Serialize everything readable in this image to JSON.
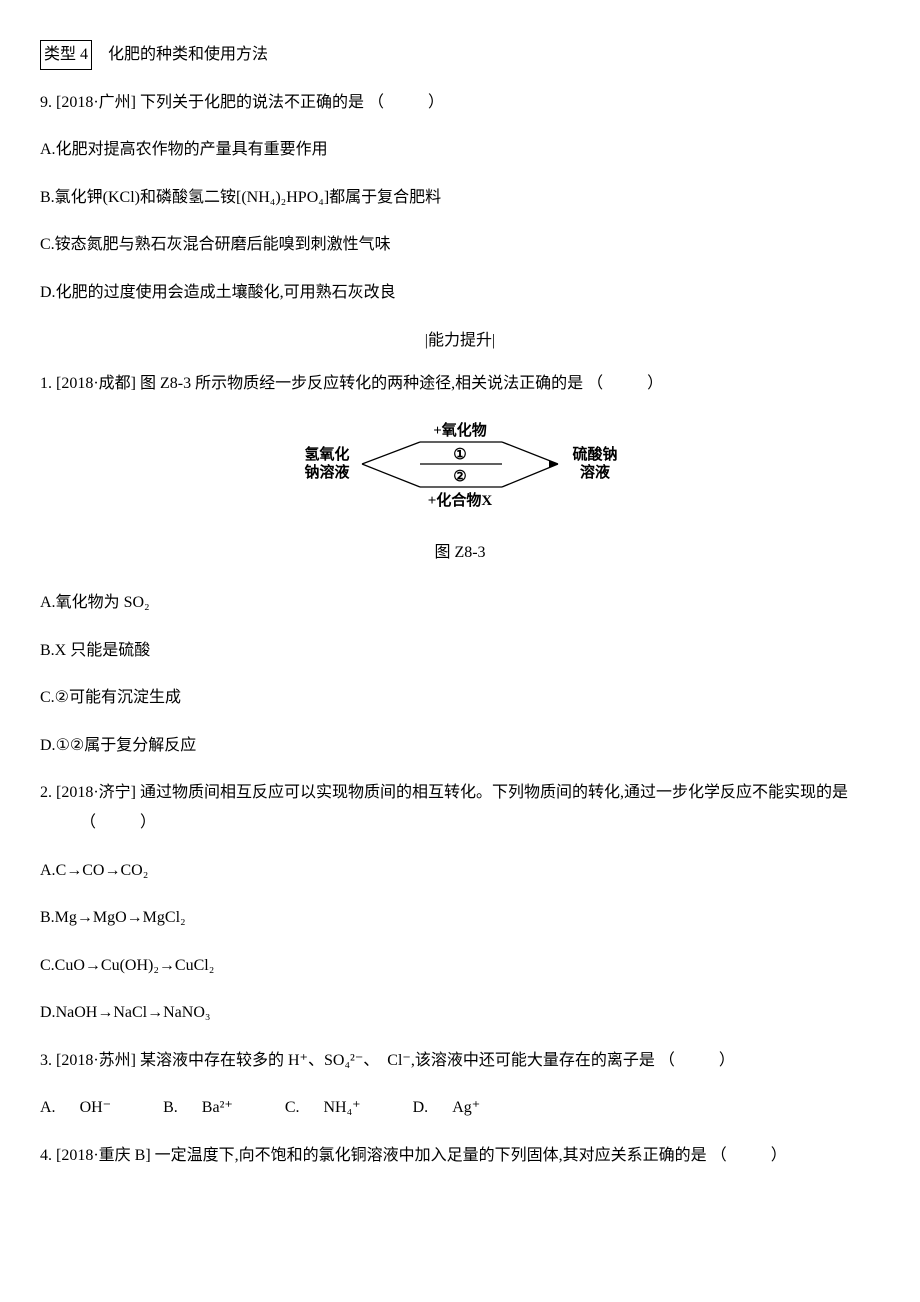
{
  "category": {
    "box": "类型 4",
    "title": "化肥的种类和使用方法"
  },
  "q9": {
    "prefix": "9.",
    "source": "[2018·广州]",
    "stem": "下列关于化肥的说法不正确的是",
    "paren": "（　　）",
    "optA_pre": "A.",
    "optA": "化肥对提高农作物的产量具有重要作用",
    "optB_pre": "B.",
    "optB": "氯化钾(KCl)和磷酸氢二铵[(NH₄)₂HPO₄]都属于复合肥料",
    "optC_pre": "C.",
    "optC": "铵态氮肥与熟石灰混合研磨后能嗅到刺激性气味",
    "optD_pre": "D.",
    "optD": "化肥的过度使用会造成土壤酸化,可用熟石灰改良"
  },
  "section_break": "|能力提升|",
  "diagram": {
    "left1": "氢氧化",
    "left2": "钠溶液",
    "top": "+氧化物",
    "mid1": "①",
    "mid2": "②",
    "bottom": "+化合物X",
    "right1": "硫酸钠",
    "right2": "溶液",
    "caption": "图 Z8-3"
  },
  "q1": {
    "prefix": "1.",
    "source": "[2018·成都]",
    "stem1": "图 Z8-3 所示物质经一步反应转化的两种途径,相关说法正确的是",
    "paren": "（　　）",
    "optA_pre": "A.",
    "optA": "氧化物为 SO₂",
    "optB_pre": "B.",
    "optB": "X 只能是硫酸",
    "optC_pre": "C.",
    "optC": "②可能有沉淀生成",
    "optD_pre": "D.",
    "optD": "①②属于复分解反应"
  },
  "q2": {
    "prefix": "2.",
    "source": "[2018·济宁]",
    "stem": "通过物质间相互反应可以实现物质间的相互转化。下列物质间的转化,通过一步化学反应不能实现的是",
    "paren": "（　　）",
    "optA_pre": "A.",
    "optA": "C→CO→CO₂",
    "optB_pre": "B.",
    "optB": "Mg→MgO→MgCl₂",
    "optC_pre": "C.",
    "optC": "CuO→Cu(OH)₂→CuCl₂",
    "optD_pre": "D.",
    "optD": "NaOH→NaCl→NaNO₃"
  },
  "q3": {
    "prefix": "3.",
    "source": "[2018·苏州]",
    "stem1": "某溶液中存在较多的 H⁺、SO₄²⁻、　Cl⁻,该溶液中还可能大量存在的离子是",
    "paren": "（　　）",
    "optA_pre": "A.",
    "optA": "OH⁻",
    "optB_pre": "B.",
    "optB": "Ba²⁺",
    "optC_pre": "C.",
    "optC": "NH₄⁺",
    "optD_pre": "D.",
    "optD": "Ag⁺"
  },
  "q4": {
    "prefix": "4.",
    "source": "[2018·重庆 B]",
    "stem": "一定温度下,向不饱和的氯化铜溶液中加入足量的下列固体,其对应关系正确的是",
    "paren": "（　　）"
  }
}
